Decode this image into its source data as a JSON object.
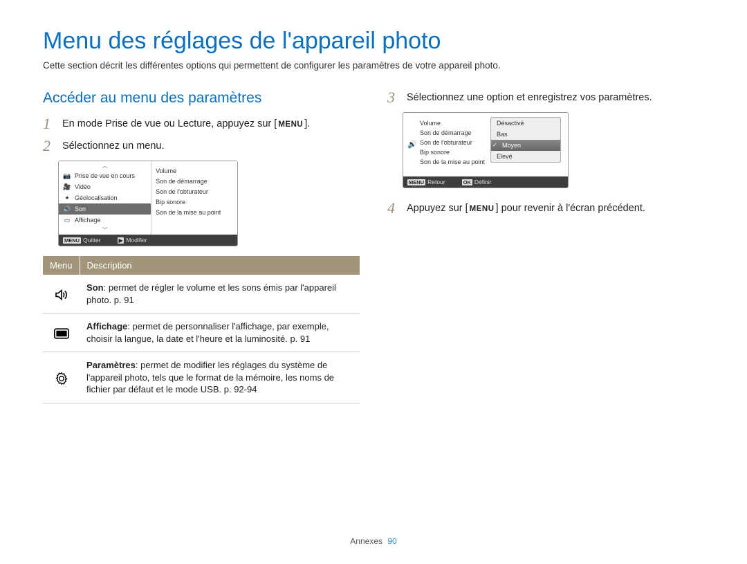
{
  "title": "Menu des réglages de l'appareil photo",
  "intro": "Cette section décrit les différentes options qui permettent de configurer les paramètres de votre appareil photo.",
  "subtitle": "Accéder au menu des paramètres",
  "steps": {
    "s1": {
      "num": "1",
      "pre": "En mode Prise de vue ou Lecture, appuyez sur [",
      "chip": "MENU",
      "post": "]."
    },
    "s2": {
      "num": "2",
      "text": "Sélectionnez un menu."
    },
    "s3": {
      "num": "3",
      "text": "Sélectionnez une option et enregistrez vos paramètres."
    },
    "s4": {
      "num": "4",
      "pre": "Appuyez sur [",
      "chip": "MENU",
      "post": "] pour revenir à l'écran précédent."
    }
  },
  "lcd2": {
    "left": [
      "Prise de vue en cours",
      "Vidéo",
      "Géolocalisation",
      "Son",
      "Affichage"
    ],
    "selected_index": 3,
    "right": [
      "Volume",
      "Son de démarrage",
      "Son de l'obturateur",
      "Bip sonore",
      "Son de la mise au point"
    ],
    "foot_left_key": "MENU",
    "foot_left": "Quitter",
    "foot_right_key": "▶",
    "foot_right": "Modifier"
  },
  "lcd3": {
    "left_icon": "sound-icon",
    "list": [
      "Volume",
      "Son de démarrage",
      "Son de l'obturateur",
      "Bip sonore",
      "Son de la mise au point"
    ],
    "popup": [
      "Désactivé",
      "Bas",
      "Moyen",
      "Elevé"
    ],
    "popup_selected_index": 2,
    "foot_left_key": "MENU",
    "foot_left": "Retour",
    "foot_right_key": "OK",
    "foot_right": "Définir"
  },
  "table": {
    "head": {
      "c1": "Menu",
      "c2": "Description"
    },
    "rows": [
      {
        "icon": "sound-icon",
        "title": "Son",
        "text": ": permet de régler le volume et les sons émis par l'appareil photo. p. 91"
      },
      {
        "icon": "display-icon",
        "title": "Affichage",
        "text": ": permet de personnaliser l'affichage, par exemple, choisir la langue, la date et l'heure et la luminosité. p. 91"
      },
      {
        "icon": "gear-icon",
        "title": "Paramètres",
        "text": ": permet de modifier les réglages du système de l'appareil photo, tels que le format de la mémoire, les noms de fichier par défaut et le mode USB. p. 92-94"
      }
    ]
  },
  "footer": {
    "section": "Annexes",
    "page": "90"
  }
}
